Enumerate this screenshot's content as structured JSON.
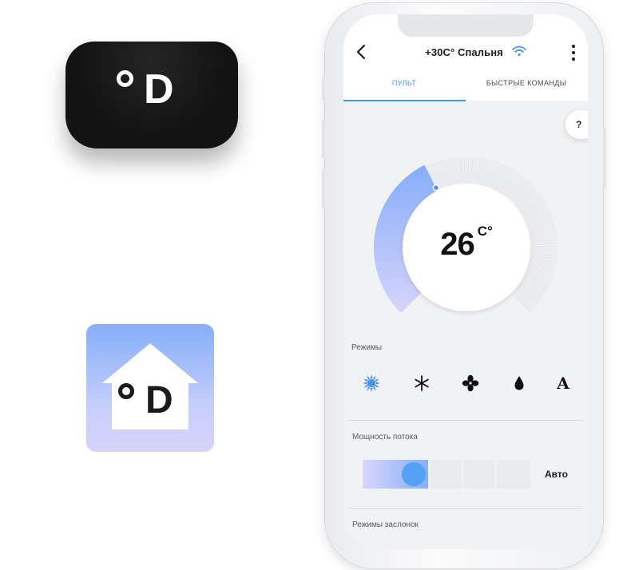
{
  "device": {
    "logo_letter": "D"
  },
  "app_icon": {
    "logo_letter": "D"
  },
  "header": {
    "title": "+30C° Спальня",
    "back_icon": "chevron-left-icon",
    "wifi_icon": "wifi-icon",
    "menu_icon": "more-vertical-icon",
    "tabs": [
      {
        "label": "ПУЛЬТ",
        "active": true
      },
      {
        "label": "БЫСТРЫЕ КОМАНДЫ",
        "active": false
      }
    ]
  },
  "help": {
    "label": "?"
  },
  "thermostat": {
    "temperature": "26",
    "unit": "C°",
    "level_fraction": 0.4,
    "accent": "#4a94ee"
  },
  "modes": {
    "label": "Режимы",
    "items": [
      {
        "icon": "sun-icon",
        "active": true
      },
      {
        "icon": "snowflake-icon",
        "active": false
      },
      {
        "icon": "fan-icon",
        "active": false
      },
      {
        "icon": "drop-icon",
        "active": false
      },
      {
        "icon": "auto-icon",
        "glyph": "A",
        "active": false
      }
    ]
  },
  "flow": {
    "label": "Мощность потока",
    "value_label": "Авто",
    "segments": 4,
    "level": 1
  },
  "dampers": {
    "label": "Режимы заслонок"
  },
  "colors": {
    "accent": "#4a94ee",
    "gradient_top": "#86aefa",
    "gradient_bottom": "#d8d3fb"
  }
}
